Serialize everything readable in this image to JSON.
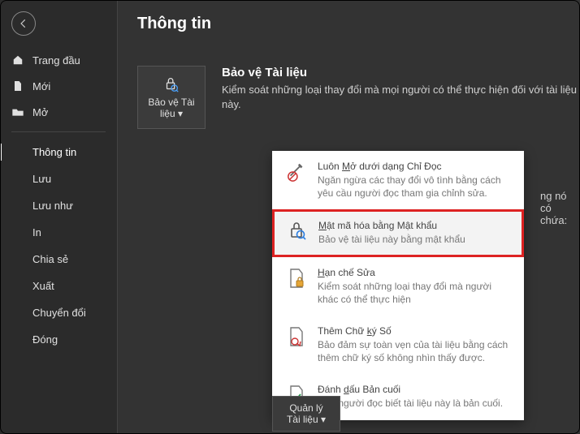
{
  "back_icon": "←",
  "sidebar": {
    "top": [
      {
        "icon": "home",
        "label": "Trang đầu"
      },
      {
        "icon": "page",
        "label": "Mới"
      },
      {
        "icon": "open",
        "label": "Mở"
      }
    ],
    "mid": [
      {
        "label": "Thông tin",
        "active": true
      },
      {
        "label": "Lưu"
      },
      {
        "label": "Lưu như"
      },
      {
        "label": "In"
      },
      {
        "label": "Chia sẻ"
      },
      {
        "label": "Xuất"
      },
      {
        "label": "Chuyển đổi"
      },
      {
        "label": "Đóng"
      }
    ]
  },
  "page_title": "Thông tin",
  "protect": {
    "button_line1": "Bảo vệ Tài",
    "button_line2": "liệu",
    "title": "Bảo vệ Tài liệu",
    "desc": "Kiểm soát những loại thay đổi mà mọi người có thể thực hiện đối với tài liệu này."
  },
  "peek_text": "ng nó có chứa:",
  "menu": [
    {
      "title_pre": "Luôn ",
      "title_u": "M",
      "title_post": "ở dưới dạng Chỉ Đọc",
      "desc": "Ngăn ngừa các thay đổi vô tình bằng cách yêu cầu người đọc tham gia chỉnh sửa.",
      "highlight": false
    },
    {
      "title_pre": "",
      "title_u": "M",
      "title_post": "ật mã hóa bằng Mật khẩu",
      "desc": "Bảo vệ tài liệu này bằng mật khẩu",
      "highlight": true
    },
    {
      "title_pre": "",
      "title_u": "H",
      "title_post": "ạn chế Sửa",
      "desc": "Kiểm soát những loại thay đổi mà người khác có thể thực hiện",
      "highlight": false
    },
    {
      "title_pre": "Thêm Chữ ",
      "title_u": "k",
      "title_post": "ý Số",
      "desc": "Bảo đảm sự toàn vẹn của tài liệu bằng cách thêm chữ ký số không nhìn thấy được.",
      "highlight": false
    },
    {
      "title_pre": "Đánh ",
      "title_u": "d",
      "title_post": "ấu Bản cuối",
      "desc": "Cho người đọc biết tài liệu này là bản cuối.",
      "highlight": false
    }
  ],
  "manage": {
    "line1": "Quản lý",
    "line2": "Tài liệu"
  }
}
